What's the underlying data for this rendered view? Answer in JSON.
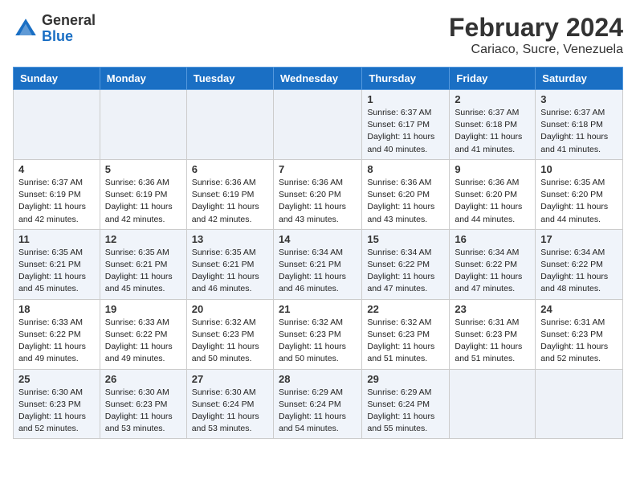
{
  "header": {
    "logo_general": "General",
    "logo_blue": "Blue",
    "month_year": "February 2024",
    "location": "Cariaco, Sucre, Venezuela"
  },
  "weekdays": [
    "Sunday",
    "Monday",
    "Tuesday",
    "Wednesday",
    "Thursday",
    "Friday",
    "Saturday"
  ],
  "weeks": [
    [
      {
        "day": "",
        "info": ""
      },
      {
        "day": "",
        "info": ""
      },
      {
        "day": "",
        "info": ""
      },
      {
        "day": "",
        "info": ""
      },
      {
        "day": "1",
        "info": "Sunrise: 6:37 AM\nSunset: 6:17 PM\nDaylight: 11 hours and 40 minutes."
      },
      {
        "day": "2",
        "info": "Sunrise: 6:37 AM\nSunset: 6:18 PM\nDaylight: 11 hours and 41 minutes."
      },
      {
        "day": "3",
        "info": "Sunrise: 6:37 AM\nSunset: 6:18 PM\nDaylight: 11 hours and 41 minutes."
      }
    ],
    [
      {
        "day": "4",
        "info": "Sunrise: 6:37 AM\nSunset: 6:19 PM\nDaylight: 11 hours and 42 minutes."
      },
      {
        "day": "5",
        "info": "Sunrise: 6:36 AM\nSunset: 6:19 PM\nDaylight: 11 hours and 42 minutes."
      },
      {
        "day": "6",
        "info": "Sunrise: 6:36 AM\nSunset: 6:19 PM\nDaylight: 11 hours and 42 minutes."
      },
      {
        "day": "7",
        "info": "Sunrise: 6:36 AM\nSunset: 6:20 PM\nDaylight: 11 hours and 43 minutes."
      },
      {
        "day": "8",
        "info": "Sunrise: 6:36 AM\nSunset: 6:20 PM\nDaylight: 11 hours and 43 minutes."
      },
      {
        "day": "9",
        "info": "Sunrise: 6:36 AM\nSunset: 6:20 PM\nDaylight: 11 hours and 44 minutes."
      },
      {
        "day": "10",
        "info": "Sunrise: 6:35 AM\nSunset: 6:20 PM\nDaylight: 11 hours and 44 minutes."
      }
    ],
    [
      {
        "day": "11",
        "info": "Sunrise: 6:35 AM\nSunset: 6:21 PM\nDaylight: 11 hours and 45 minutes."
      },
      {
        "day": "12",
        "info": "Sunrise: 6:35 AM\nSunset: 6:21 PM\nDaylight: 11 hours and 45 minutes."
      },
      {
        "day": "13",
        "info": "Sunrise: 6:35 AM\nSunset: 6:21 PM\nDaylight: 11 hours and 46 minutes."
      },
      {
        "day": "14",
        "info": "Sunrise: 6:34 AM\nSunset: 6:21 PM\nDaylight: 11 hours and 46 minutes."
      },
      {
        "day": "15",
        "info": "Sunrise: 6:34 AM\nSunset: 6:22 PM\nDaylight: 11 hours and 47 minutes."
      },
      {
        "day": "16",
        "info": "Sunrise: 6:34 AM\nSunset: 6:22 PM\nDaylight: 11 hours and 47 minutes."
      },
      {
        "day": "17",
        "info": "Sunrise: 6:34 AM\nSunset: 6:22 PM\nDaylight: 11 hours and 48 minutes."
      }
    ],
    [
      {
        "day": "18",
        "info": "Sunrise: 6:33 AM\nSunset: 6:22 PM\nDaylight: 11 hours and 49 minutes."
      },
      {
        "day": "19",
        "info": "Sunrise: 6:33 AM\nSunset: 6:22 PM\nDaylight: 11 hours and 49 minutes."
      },
      {
        "day": "20",
        "info": "Sunrise: 6:32 AM\nSunset: 6:23 PM\nDaylight: 11 hours and 50 minutes."
      },
      {
        "day": "21",
        "info": "Sunrise: 6:32 AM\nSunset: 6:23 PM\nDaylight: 11 hours and 50 minutes."
      },
      {
        "day": "22",
        "info": "Sunrise: 6:32 AM\nSunset: 6:23 PM\nDaylight: 11 hours and 51 minutes."
      },
      {
        "day": "23",
        "info": "Sunrise: 6:31 AM\nSunset: 6:23 PM\nDaylight: 11 hours and 51 minutes."
      },
      {
        "day": "24",
        "info": "Sunrise: 6:31 AM\nSunset: 6:23 PM\nDaylight: 11 hours and 52 minutes."
      }
    ],
    [
      {
        "day": "25",
        "info": "Sunrise: 6:30 AM\nSunset: 6:23 PM\nDaylight: 11 hours and 52 minutes."
      },
      {
        "day": "26",
        "info": "Sunrise: 6:30 AM\nSunset: 6:23 PM\nDaylight: 11 hours and 53 minutes."
      },
      {
        "day": "27",
        "info": "Sunrise: 6:30 AM\nSunset: 6:24 PM\nDaylight: 11 hours and 53 minutes."
      },
      {
        "day": "28",
        "info": "Sunrise: 6:29 AM\nSunset: 6:24 PM\nDaylight: 11 hours and 54 minutes."
      },
      {
        "day": "29",
        "info": "Sunrise: 6:29 AM\nSunset: 6:24 PM\nDaylight: 11 hours and 55 minutes."
      },
      {
        "day": "",
        "info": ""
      },
      {
        "day": "",
        "info": ""
      }
    ]
  ]
}
